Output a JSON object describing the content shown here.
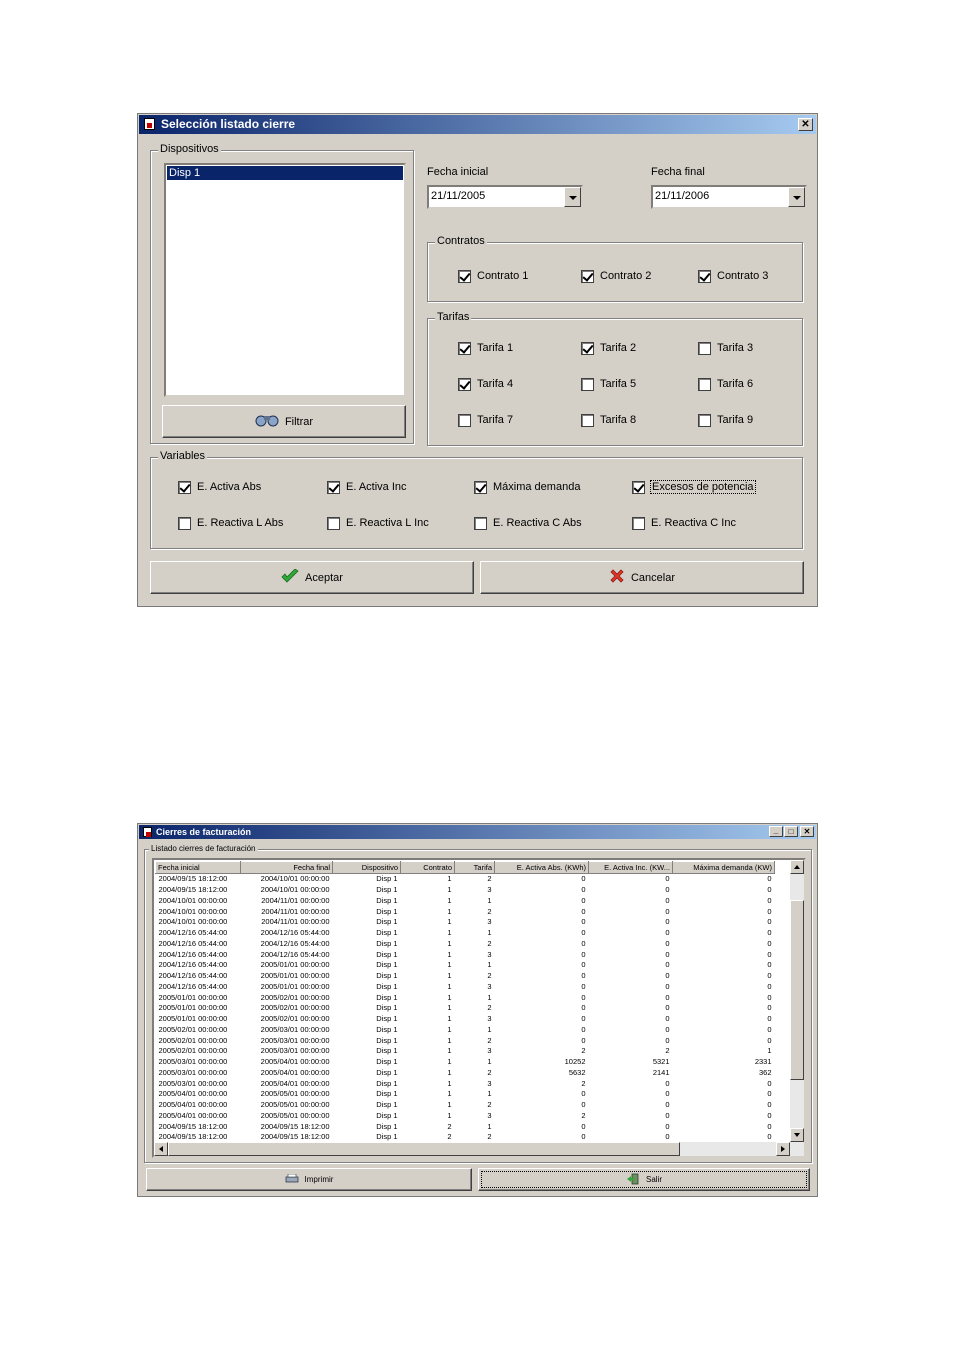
{
  "dialog": {
    "title": "Selección listado cierre",
    "close_glyph": "✕",
    "devices_group": "Dispositivos",
    "device_list": [
      "Disp 1"
    ],
    "filter_button": "Filtrar",
    "fecha_inicial_label": "Fecha inicial",
    "fecha_inicial_value": "21/11/2005",
    "fecha_final_label": "Fecha final",
    "fecha_final_value": "21/11/2006",
    "contratos_group": "Contratos",
    "contratos": [
      {
        "label": "Contrato 1",
        "checked": true
      },
      {
        "label": "Contrato 2",
        "checked": true
      },
      {
        "label": "Contrato 3",
        "checked": true
      }
    ],
    "tarifas_group": "Tarifas",
    "tarifas": [
      {
        "label": "Tarifa 1",
        "checked": true
      },
      {
        "label": "Tarifa 2",
        "checked": true
      },
      {
        "label": "Tarifa 3",
        "checked": false
      },
      {
        "label": "Tarifa 4",
        "checked": true
      },
      {
        "label": "Tarifa 5",
        "checked": false
      },
      {
        "label": "Tarifa 6",
        "checked": false
      },
      {
        "label": "Tarifa 7",
        "checked": false
      },
      {
        "label": "Tarifa 8",
        "checked": false
      },
      {
        "label": "Tarifa 9",
        "checked": false
      }
    ],
    "variables_group": "Variables",
    "variables": [
      {
        "label": "E. Activa Abs",
        "checked": true
      },
      {
        "label": "E. Activa Inc",
        "checked": true
      },
      {
        "label": "Máxima demanda",
        "checked": true
      },
      {
        "label": "Excesos de potencia",
        "checked": true
      },
      {
        "label": "E. Reactiva L Abs",
        "checked": false
      },
      {
        "label": "E. Reactiva L Inc",
        "checked": false
      },
      {
        "label": "E. Reactiva C Abs",
        "checked": false
      },
      {
        "label": "E. Reactiva C Inc",
        "checked": false
      }
    ],
    "accept_button": "Aceptar",
    "cancel_button": "Cancelar"
  },
  "report": {
    "title": "Cierres de facturación",
    "minimize_glyph": "_",
    "maximize_glyph": "□",
    "close_glyph": "✕",
    "group": "Listado cierres de facturación",
    "columns": [
      "Fecha inicial",
      "Fecha final",
      "Dispositivo",
      "Contrato",
      "Tarifa",
      "E. Activa Abs. (KWh)",
      "E. Activa Inc. (KW...",
      "Máxima demanda (KW)"
    ],
    "rows": [
      [
        "2004/09/15 18:12:00",
        "2004/10/01 00:00:00",
        "Disp 1",
        "1",
        "2",
        "0",
        "0",
        "0"
      ],
      [
        "2004/09/15 18:12:00",
        "2004/10/01 00:00:00",
        "Disp 1",
        "1",
        "3",
        "0",
        "0",
        "0"
      ],
      [
        "2004/10/01 00:00:00",
        "2004/11/01 00:00:00",
        "Disp 1",
        "1",
        "1",
        "0",
        "0",
        "0"
      ],
      [
        "2004/10/01 00:00:00",
        "2004/11/01 00:00:00",
        "Disp 1",
        "1",
        "2",
        "0",
        "0",
        "0"
      ],
      [
        "2004/10/01 00:00:00",
        "2004/11/01 00:00:00",
        "Disp 1",
        "1",
        "3",
        "0",
        "0",
        "0"
      ],
      [
        "2004/12/16 05:44:00",
        "2004/12/16 05:44:00",
        "Disp 1",
        "1",
        "1",
        "0",
        "0",
        "0"
      ],
      [
        "2004/12/16 05:44:00",
        "2004/12/16 05:44:00",
        "Disp 1",
        "1",
        "2",
        "0",
        "0",
        "0"
      ],
      [
        "2004/12/16 05:44:00",
        "2004/12/16 05:44:00",
        "Disp 1",
        "1",
        "3",
        "0",
        "0",
        "0"
      ],
      [
        "2004/12/16 05:44:00",
        "2005/01/01 00:00:00",
        "Disp 1",
        "1",
        "1",
        "0",
        "0",
        "0"
      ],
      [
        "2004/12/16 05:44:00",
        "2005/01/01 00:00:00",
        "Disp 1",
        "1",
        "2",
        "0",
        "0",
        "0"
      ],
      [
        "2004/12/16 05:44:00",
        "2005/01/01 00:00:00",
        "Disp 1",
        "1",
        "3",
        "0",
        "0",
        "0"
      ],
      [
        "2005/01/01 00:00:00",
        "2005/02/01 00:00:00",
        "Disp 1",
        "1",
        "1",
        "0",
        "0",
        "0"
      ],
      [
        "2005/01/01 00:00:00",
        "2005/02/01 00:00:00",
        "Disp 1",
        "1",
        "2",
        "0",
        "0",
        "0"
      ],
      [
        "2005/01/01 00:00:00",
        "2005/02/01 00:00:00",
        "Disp 1",
        "1",
        "3",
        "0",
        "0",
        "0"
      ],
      [
        "2005/02/01 00:00:00",
        "2005/03/01 00:00:00",
        "Disp 1",
        "1",
        "1",
        "0",
        "0",
        "0"
      ],
      [
        "2005/02/01 00:00:00",
        "2005/03/01 00:00:00",
        "Disp 1",
        "1",
        "2",
        "0",
        "0",
        "0"
      ],
      [
        "2005/02/01 00:00:00",
        "2005/03/01 00:00:00",
        "Disp 1",
        "1",
        "3",
        "2",
        "2",
        "1"
      ],
      [
        "2005/03/01 00:00:00",
        "2005/04/01 00:00:00",
        "Disp 1",
        "1",
        "1",
        "10252",
        "5321",
        "2331"
      ],
      [
        "2005/03/01 00:00:00",
        "2005/04/01 00:00:00",
        "Disp 1",
        "1",
        "2",
        "5632",
        "2141",
        "362"
      ],
      [
        "2005/03/01 00:00:00",
        "2005/04/01 00:00:00",
        "Disp 1",
        "1",
        "3",
        "2",
        "0",
        "0"
      ],
      [
        "2005/04/01 00:00:00",
        "2005/05/01 00:00:00",
        "Disp 1",
        "1",
        "1",
        "0",
        "0",
        "0"
      ],
      [
        "2005/04/01 00:00:00",
        "2005/05/01 00:00:00",
        "Disp 1",
        "1",
        "2",
        "0",
        "0",
        "0"
      ],
      [
        "2005/04/01 00:00:00",
        "2005/05/01 00:00:00",
        "Disp 1",
        "1",
        "3",
        "2",
        "0",
        "0"
      ],
      [
        "2004/09/15 18:12:00",
        "2004/09/15 18:12:00",
        "Disp 1",
        "2",
        "1",
        "0",
        "0",
        "0"
      ],
      [
        "2004/09/15 18:12:00",
        "2004/09/15 18:12:00",
        "Disp 1",
        "2",
        "2",
        "0",
        "0",
        "0"
      ]
    ],
    "print_button": "Imprimir",
    "exit_button": "Salir"
  }
}
